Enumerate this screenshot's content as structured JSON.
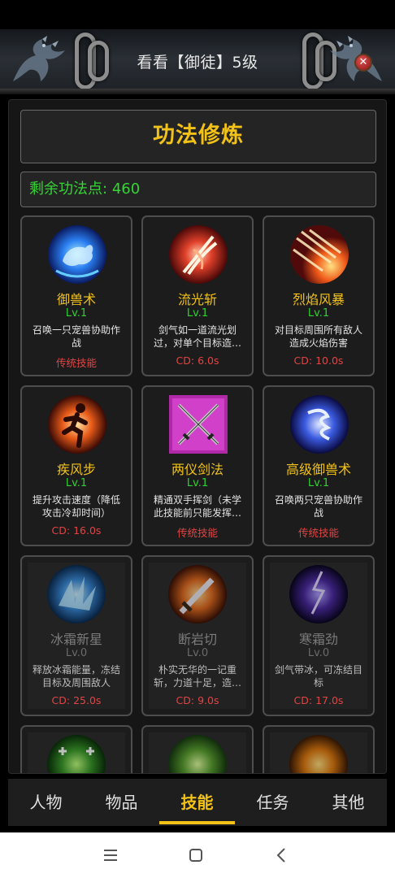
{
  "header": {
    "title": "看看【御徒】5级"
  },
  "section": {
    "title": "功法修炼",
    "points_label": "剩余功法点:",
    "points_value": "460"
  },
  "skills": [
    {
      "name": "御兽术",
      "level": "Lv.1",
      "desc": "召唤一只宠兽协助作战",
      "tag": "传统技能",
      "icon": "blue-beast-orb-icon",
      "locked": false
    },
    {
      "name": "流光斩",
      "level": "Lv.1",
      "desc": "剑气如一道流光划过，对单个目标造…",
      "tag": "CD: 6.0s",
      "icon": "red-slash-icon",
      "locked": false
    },
    {
      "name": "烈焰风暴",
      "level": "Lv.1",
      "desc": "对目标周围所有敌人造成火焰伤害",
      "tag": "CD: 10.0s",
      "icon": "fire-meteor-icon",
      "locked": false
    },
    {
      "name": "疾风步",
      "level": "Lv.1",
      "desc": "提升攻击速度（降低攻击冷却时间）",
      "tag": "CD: 16.0s",
      "icon": "running-man-icon",
      "locked": false
    },
    {
      "name": "两仪剑法",
      "level": "Lv.1",
      "desc": "精通双手挥剑（未学此技能前只能发挥…",
      "tag": "传统技能",
      "icon": "crossed-swords-icon",
      "locked": false
    },
    {
      "name": "高级御兽术",
      "level": "Lv.1",
      "desc": "召唤两只宠兽协助作战",
      "tag": "传统技能",
      "icon": "blue-dragon-orb-icon",
      "locked": false
    },
    {
      "name": "冰霜新星",
      "level": "Lv.0",
      "desc": "释放冰霜能量，冻结目标及周围敌人",
      "tag": "CD: 25.0s",
      "icon": "ice-shards-icon",
      "locked": true
    },
    {
      "name": "断岩切",
      "level": "Lv.0",
      "desc": "朴实无华的一记重斩，力道十足，造…",
      "tag": "CD: 9.0s",
      "icon": "broad-sword-icon",
      "locked": true
    },
    {
      "name": "寒霜劲",
      "level": "Lv.0",
      "desc": "剑气带冰，可冻结目标",
      "tag": "CD: 17.0s",
      "icon": "frost-lightning-icon",
      "locked": true
    },
    {
      "name": "",
      "level": "",
      "desc": "",
      "tag": "",
      "icon": "heal-cross-icon",
      "locked": true
    },
    {
      "name": "",
      "level": "",
      "desc": "",
      "tag": "",
      "icon": "green-aura-icon",
      "locked": true
    },
    {
      "name": "",
      "level": "",
      "desc": "",
      "tag": "",
      "icon": "fire-axe-icon",
      "locked": true
    }
  ],
  "tabs": [
    {
      "label": "人物"
    },
    {
      "label": "物品"
    },
    {
      "label": "技能"
    },
    {
      "label": "任务"
    },
    {
      "label": "其他"
    }
  ],
  "active_tab": "技能",
  "colors": {
    "accent": "#f2c218",
    "points_green": "#33d633",
    "level_green": "#2fd22f",
    "tag_red": "#e24444"
  }
}
